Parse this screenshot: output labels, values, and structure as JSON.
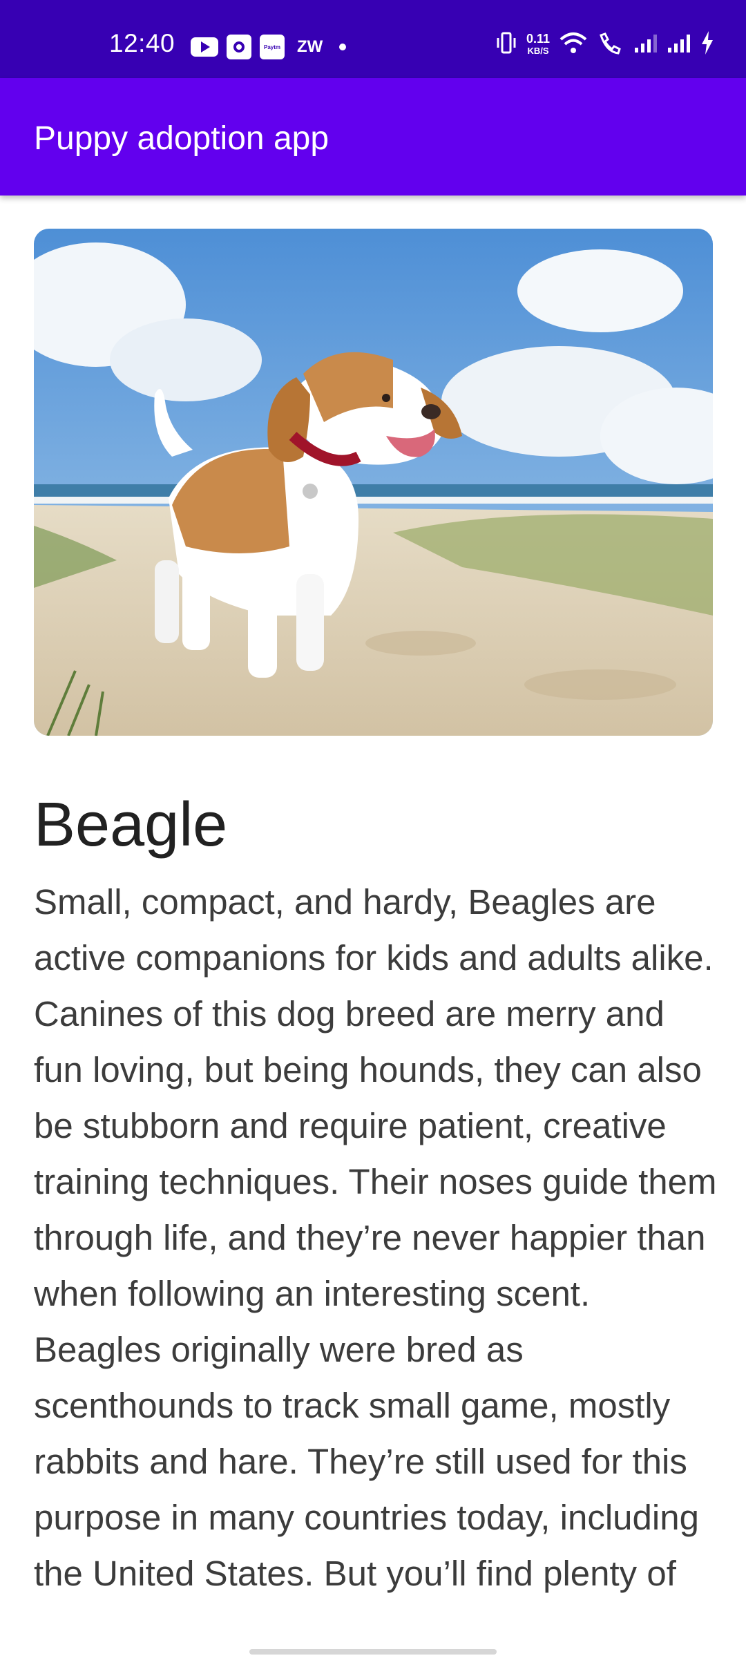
{
  "status_bar": {
    "time": "12:40",
    "left_icons": [
      "youtube-icon",
      "messaging-app-icon",
      "paytm-icon",
      "zw-icon",
      "dot-icon"
    ],
    "notification_label_zw": "ZW",
    "paytm_label": "Paytm",
    "net_speed_value": "0.11",
    "net_speed_unit": "KB/S",
    "right_icons": [
      "vibrate-icon",
      "wifi-icon",
      "wifi-calling-icon",
      "signal-1-icon",
      "signal-2-icon",
      "charging-icon"
    ]
  },
  "app_bar": {
    "title": "Puppy adoption app",
    "background_color": "#6200ee",
    "status_color": "#3700b3"
  },
  "puppy": {
    "image_icon": "beagle-photo",
    "name": "Beagle",
    "description": "Small, compact, and hardy, Beagles are active companions for kids and adults alike. Canines of this dog breed are merry and fun loving, but being hounds, they can also be stubborn and require patient, creative training techniques. Their noses guide them through life, and they’re never happier than when following an interesting scent. Beagles originally were bred as scenthounds to track small game, mostly rabbits and hare. They’re still used for this purpose in many countries today, including the United States. But you’ll find plenty of"
  }
}
